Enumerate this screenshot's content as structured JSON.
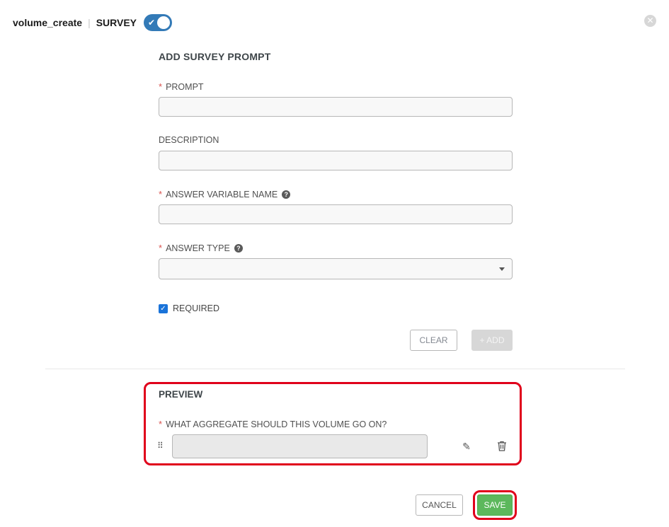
{
  "header": {
    "job_name": "volume_create",
    "separator": "|",
    "survey_label": "SURVEY",
    "survey_enabled": true
  },
  "form": {
    "title": "ADD SURVEY PROMPT",
    "required_marker": "*",
    "help_glyph": "?",
    "prompt_label": "PROMPT",
    "prompt_value": "",
    "description_label": "DESCRIPTION",
    "description_value": "",
    "variable_label": "ANSWER VARIABLE NAME",
    "variable_value": "",
    "answer_type_label": "ANSWER TYPE",
    "answer_type_value": "",
    "required_label": "REQUIRED",
    "required_checked": true,
    "clear_label": "CLEAR",
    "add_label": "+ ADD"
  },
  "preview": {
    "title": "PREVIEW",
    "question": "WHAT AGGREGATE SHOULD THIS VOLUME GO ON?",
    "answer_value": ""
  },
  "footer": {
    "cancel_label": "CANCEL",
    "save_label": "SAVE"
  },
  "colors": {
    "toggle": "#337ab7",
    "save": "#5cb85c",
    "highlight": "#e0001b",
    "required": "#d9534f"
  },
  "icons": {
    "close": "close-icon",
    "help": "question-circle-icon",
    "drag": "drag-handle-icon",
    "edit": "pencil-icon",
    "delete": "trash-icon"
  }
}
